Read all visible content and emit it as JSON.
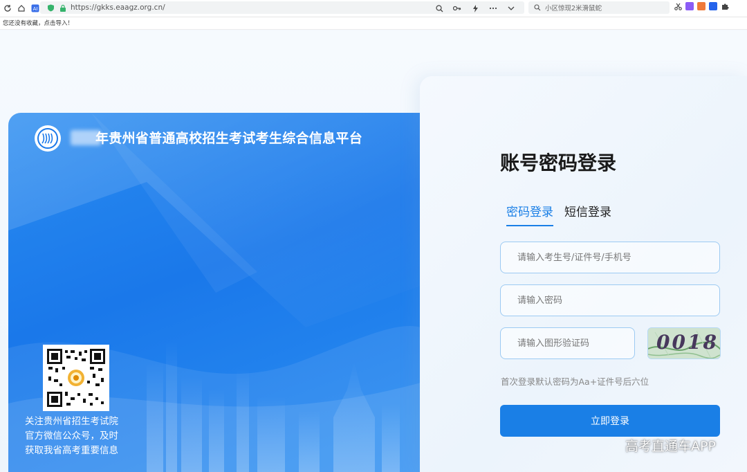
{
  "browser": {
    "url": "https://gkks.eaagz.org.cn/",
    "search_text": "小区惊现2米滑鼠蛇",
    "favorites_hint": "您还没有收藏，点击导入！"
  },
  "banner": {
    "title": "年贵州省普通高校招生考试考生综合信息平台",
    "qr_caption": [
      "关注贵州省招生考试院",
      "官方微信公众号，及时",
      "获取我省高考重要信息"
    ]
  },
  "login": {
    "heading": "账号密码登录",
    "tabs": [
      {
        "label": "密码登录",
        "active": true
      },
      {
        "label": "短信登录",
        "active": false
      }
    ],
    "account_placeholder": "请输入考生号/证件号/手机号",
    "password_placeholder": "请输入密码",
    "captcha_placeholder": "请输入图形验证码",
    "captcha_text": "0018",
    "hint": "首次登录默认密码为Aa+证件号后六位",
    "submit_label": "立即登录"
  },
  "watermark": "高考直通车APP",
  "colors": {
    "accent": "#1a7fe6",
    "banner_blue": "#1a78ea",
    "field_border": "#9ccaf2"
  }
}
